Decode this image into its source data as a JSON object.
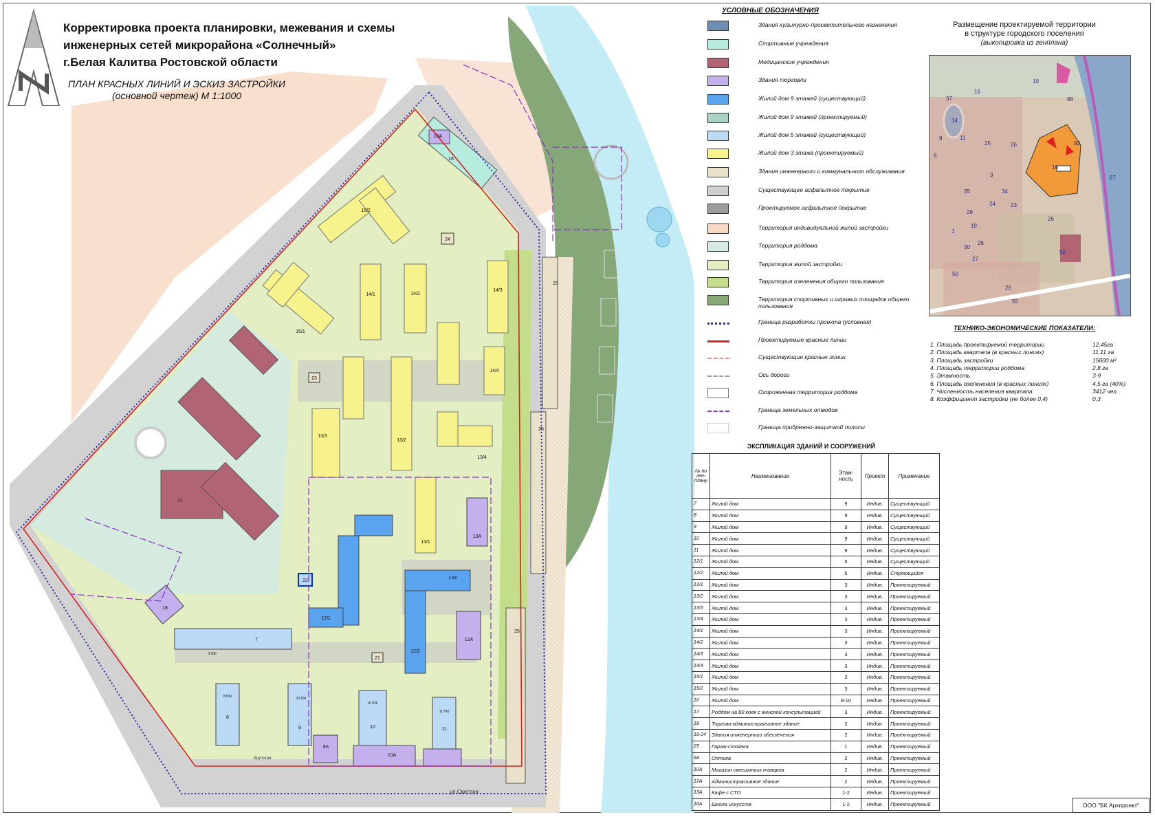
{
  "title": "Корректировка проекта планировки, межевания и схемы\nинженерных сетей микрорайона «Солнечный»\nг.Белая Калитва Ростовской области",
  "subtitle": "ПЛАН КРАСНЫХ ЛИНИЙ И ЭСКИЗ ЗАСТРОЙКИ\n(основной чертеж) М 1:1000",
  "legend": {
    "title": "УСЛОВНЫЕ ОБОЗНАЧЕНИЯ",
    "items": [
      {
        "label": "Здания культурно-просветительного назначения",
        "color": "#6e8fb5",
        "kind": "fill"
      },
      {
        "label": "Спортивные учреждения",
        "color": "#b6ecde",
        "kind": "fill"
      },
      {
        "label": "Медицинские учреждения",
        "color": "#b06474",
        "kind": "fill"
      },
      {
        "label": "Здания торговли",
        "color": "#c4b0ec",
        "kind": "fill"
      },
      {
        "label": "Жилой дом 9 этажей (существующий)",
        "color": "#5aa3ee",
        "kind": "fill"
      },
      {
        "label": "Жилой дом 9 этажей (проектируемый)",
        "color": "#a7d2c4",
        "kind": "fill"
      },
      {
        "label": "Жилой дом 5 этажей (существующий)",
        "color": "#bcd9f5",
        "kind": "fill"
      },
      {
        "label": "Жилой дом 3 этажа (проектируемый)",
        "color": "#f6f28c",
        "kind": "fill"
      },
      {
        "label": "Здания инженерного и коммунального обслуживания",
        "color": "#e9e1c9",
        "kind": "fill"
      },
      {
        "label": "Существующее асфальтное покрытие",
        "color": "#cfcfcf",
        "kind": "fill"
      },
      {
        "label": "Проетируемое асфальтное покрытие",
        "color": "#9c9c9c",
        "kind": "fill"
      },
      {
        "label": "Территория индивидуальной жилой застройки",
        "color": "#f7d9c6",
        "kind": "fill"
      },
      {
        "label": "Территория роддома",
        "color": "#d5ebe0",
        "kind": "fill"
      },
      {
        "label": "Территория жилой застройки",
        "color": "#e3efc2",
        "kind": "fill"
      },
      {
        "label": "Территория озеленения общего пользования",
        "color": "#c4dd8a",
        "kind": "fill"
      },
      {
        "label": "Территория спортивных и игровых площадок общего пользования",
        "color": "#86a878",
        "kind": "fill"
      },
      {
        "label": "Граница разработки проекта (условная)",
        "color": "#2a2aa0",
        "kind": "dotted"
      },
      {
        "label": "Проектируемые красные линии",
        "color": "#d42020",
        "kind": "solid"
      },
      {
        "label": "Существующие красные линии",
        "color": "#e79090",
        "kind": "dashed"
      },
      {
        "label": "Ось дороги",
        "color": "#999999",
        "kind": "dashdot"
      },
      {
        "label": "Огороженная территория роддома",
        "color": "#777777",
        "kind": "fence"
      },
      {
        "label": "Граница земельных отводов",
        "color": "#8b2fc7",
        "kind": "dashlong"
      },
      {
        "label": "Граница прибрежно-защитной полосы",
        "color": "#e2b7a4",
        "kind": "band"
      }
    ]
  },
  "inset": {
    "title": "Размещение проектируемой территории\nв структуре городского поселения",
    "subtitle": "(выкопировка из генплана)",
    "labels": [
      "10",
      "37",
      "14",
      "16",
      "9",
      "11",
      "25",
      "26",
      "8",
      "25",
      "34",
      "23",
      "26",
      "24",
      "19",
      "30",
      "26",
      "50",
      "26",
      "92",
      "27",
      "26",
      "55",
      "16",
      "3",
      "88",
      "92",
      "87",
      "1"
    ]
  },
  "tep": {
    "title": "ТЕХНИКО-ЭКОНОМИЧЕСКИЕ ПОКАЗАТЕЛИ:",
    "rows": [
      {
        "label": "1. Площадь проектируемой территории",
        "value": "12,45га"
      },
      {
        "label": "2.  Площадь квартала (в красных линиях)",
        "value": "11,11  га"
      },
      {
        "label": "3.  Площадь застройки",
        "value": "15600 м²"
      },
      {
        "label": "4. Площадь территории роддома",
        "value": "2,8 га"
      },
      {
        "label": "5.  Этажность",
        "value": "3-9"
      },
      {
        "label": "6.  Площадь озеленения (в красных линиях)",
        "value": "4,5 га (40%)"
      },
      {
        "label": "7. Численность населения квартала",
        "value": "3412 чел."
      },
      {
        "label": "8. Коэффициент застройки (не более 0,4)",
        "value": "0,3"
      }
    ]
  },
  "explication": {
    "title": "ЭКСПЛИКАЦИЯ ЗДАНИЙ И СООРУЖЕНИЙ",
    "headers": [
      "№ по ген-плану",
      "Наименование",
      "Этаж-ность",
      "Проект",
      "Примечание"
    ],
    "rows": [
      [
        "7",
        "Жилой дом",
        "9",
        "Индив.",
        "Существующий"
      ],
      [
        "8",
        "Жилой дом",
        "9",
        "Индив.",
        "Существующий"
      ],
      [
        "9",
        "Жилой дом",
        "9",
        "Индив.",
        "Существующий"
      ],
      [
        "10",
        "Жилой дом",
        "9",
        "Индив.",
        "Существующий"
      ],
      [
        "11",
        "Жилой дом",
        "9",
        "Индив.",
        "Существующий"
      ],
      [
        "12/1",
        "Жилой дом",
        "5",
        "Индив.",
        "Существующий"
      ],
      [
        "12/2",
        "Жилой дом",
        "5",
        "Индив.",
        "Строющийся"
      ],
      [
        "13/1",
        "Жилой дом",
        "3",
        "Индив.",
        "Проектируемый"
      ],
      [
        "13/2",
        "Жилой дом",
        "3",
        "Индив.",
        "Проектируемый"
      ],
      [
        "13/3",
        "Жилой дом",
        "3",
        "Индив.",
        "Проектируемый"
      ],
      [
        "13/4",
        "Жилой дом",
        "3",
        "Индив.",
        "Проектируемый"
      ],
      [
        "14/1",
        "Жилой дом",
        "3",
        "Индив.",
        "Проектируемый"
      ],
      [
        "14/2",
        "Жилой дом",
        "3",
        "Индив.",
        "Проектируемый"
      ],
      [
        "14/3",
        "Жилой дом",
        "3",
        "Индив.",
        "Проектируемый"
      ],
      [
        "14/4",
        "Жилой дом",
        "3",
        "Индив.",
        "Проектируемый"
      ],
      [
        "15/1",
        "Жилой дом",
        "3",
        "Индив.",
        "Проектируемый"
      ],
      [
        "15/2",
        "Жилой дом",
        "3",
        "Индив.",
        "Проектируемый"
      ],
      [
        "16",
        "Жилой дом",
        "8-10",
        "Индив.",
        "Проектируемый"
      ],
      [
        "17",
        "Роддом на 80 коек с женской консультацией",
        "3",
        "Индив.",
        "Проектируемый"
      ],
      [
        "18",
        "Торгово-административное здание",
        "2",
        "Индив.",
        "Проектируемый"
      ],
      [
        "19-24",
        "Здания инженерного обеспечения",
        "2",
        "Индив.",
        "Проектируемый"
      ],
      [
        "25",
        "Гараж-стоянка",
        "1",
        "Индив.",
        "Проектируемый"
      ],
      [
        "9А",
        "Оптика",
        "2",
        "Индив.",
        "Проектируемый"
      ],
      [
        "10А",
        "Магазин смешанных товаров",
        "2",
        "Индив.",
        "Проектируемый"
      ],
      [
        "12А",
        "Административное здание",
        "2",
        "Индив.",
        "Проектируемый"
      ],
      [
        "13А",
        "Кафе с СТО",
        "1-2",
        "Индив.",
        "Проектируемый"
      ],
      [
        "16А",
        "Школа искусств",
        "1-2",
        "Индив.",
        "Проектируемый"
      ]
    ]
  },
  "map": {
    "street_labels": [
      "ул.Светлая",
      "Крупская"
    ],
    "building_labels": [
      "16А",
      "16",
      "15/2",
      "24",
      "14/1",
      "14/2",
      "14/3",
      "15/1",
      "14/4",
      "23",
      "13/3",
      "13/2",
      "13/4",
      "17",
      "13А",
      "13/1",
      "22",
      "12/1",
      "12/2",
      "12А",
      "18",
      "7",
      "21",
      "8",
      "9",
      "10",
      "11",
      "9А",
      "10А",
      "25",
      "25",
      "25"
    ],
    "floor_labels": [
      "9 ЮК",
      "5 ЮК",
      "10 ЮК",
      "11 ЮК",
      "8 ЮК",
      "10 ЮК"
    ]
  },
  "stamp": "ООО \"БК Архпроект\""
}
